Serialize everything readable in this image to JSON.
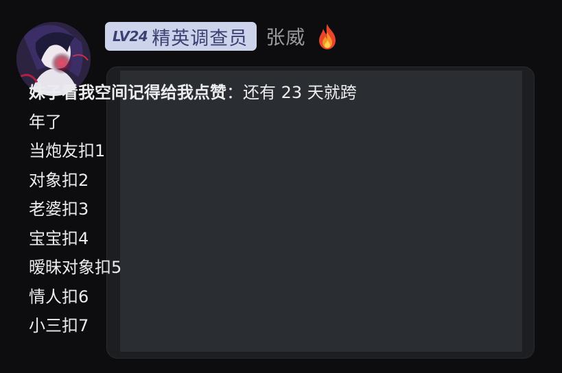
{
  "user": {
    "avatar_icon": "anime-avatar",
    "badge_level": "LV24",
    "badge_title": "精英调查员",
    "username": "张威",
    "flair_icon": "fire-icon"
  },
  "message": {
    "first_line_bold": "妹子看我空间记得给我点赞",
    "first_line_rest": "：还有 23 天就跨",
    "lines": [
      "年了",
      "当炮友扣1",
      "对象扣2",
      "老婆扣3",
      "宝宝扣4",
      "暧昧对象扣5",
      "情人扣6",
      "小三扣7"
    ]
  },
  "colors": {
    "background": "#0d0d0f",
    "badge_bg": "#cdd3ea",
    "badge_text": "#3b3f72",
    "username": "#9a9a9e",
    "bubble": "#2a2d31",
    "message_text": "#ececee"
  }
}
